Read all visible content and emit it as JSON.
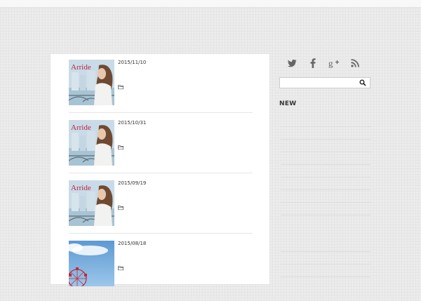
{
  "posts": [
    {
      "date": "2015/11/10",
      "thumb_text": "Arride"
    },
    {
      "date": "2015/10/31",
      "thumb_text": "Arride"
    },
    {
      "date": "2015/09/19",
      "thumb_text": "Arride"
    },
    {
      "date": "2015/08/18",
      "thumb_text": ""
    }
  ],
  "sidebar": {
    "social_icons": [
      "twitter-icon",
      "facebook-icon",
      "google-plus-icon",
      "rss-icon"
    ],
    "search_value": "",
    "search_placeholder": "",
    "new_title": "NEW"
  },
  "colors": {
    "background": "#ececec",
    "panel": "#ffffff",
    "icon": "#666666",
    "thumb_text": "#b8233f",
    "sky": "#6aa6d8"
  }
}
